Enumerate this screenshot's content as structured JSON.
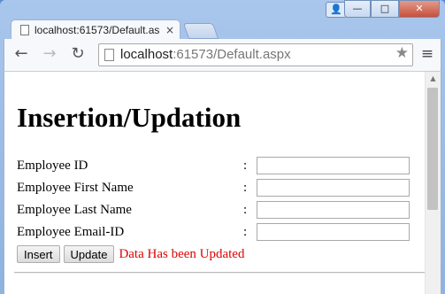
{
  "browser": {
    "tab_title": "localhost:61573/Default.as",
    "tab_close": "×",
    "url_host": "localhost",
    "url_rest": ":61573/Default.aspx",
    "nav_back": "←",
    "nav_forward": "→",
    "nav_reload": "↻",
    "star": "★",
    "menu": "≡",
    "window_controls": {
      "user": "👤",
      "minimize": "—",
      "maximize": "□",
      "close": "✕"
    }
  },
  "page": {
    "heading": "Insertion/Updation",
    "fields": [
      {
        "label": "Employee ID",
        "colon": ":",
        "value": ""
      },
      {
        "label": "Employee First Name",
        "colon": ":",
        "value": ""
      },
      {
        "label": "Employee Last Name",
        "colon": ":",
        "value": ""
      },
      {
        "label": "Employee Email-ID",
        "colon": ":",
        "value": ""
      }
    ],
    "buttons": {
      "insert": "Insert",
      "update": "Update"
    },
    "message": "Data Has been Updated",
    "message_color": "#e00000"
  }
}
